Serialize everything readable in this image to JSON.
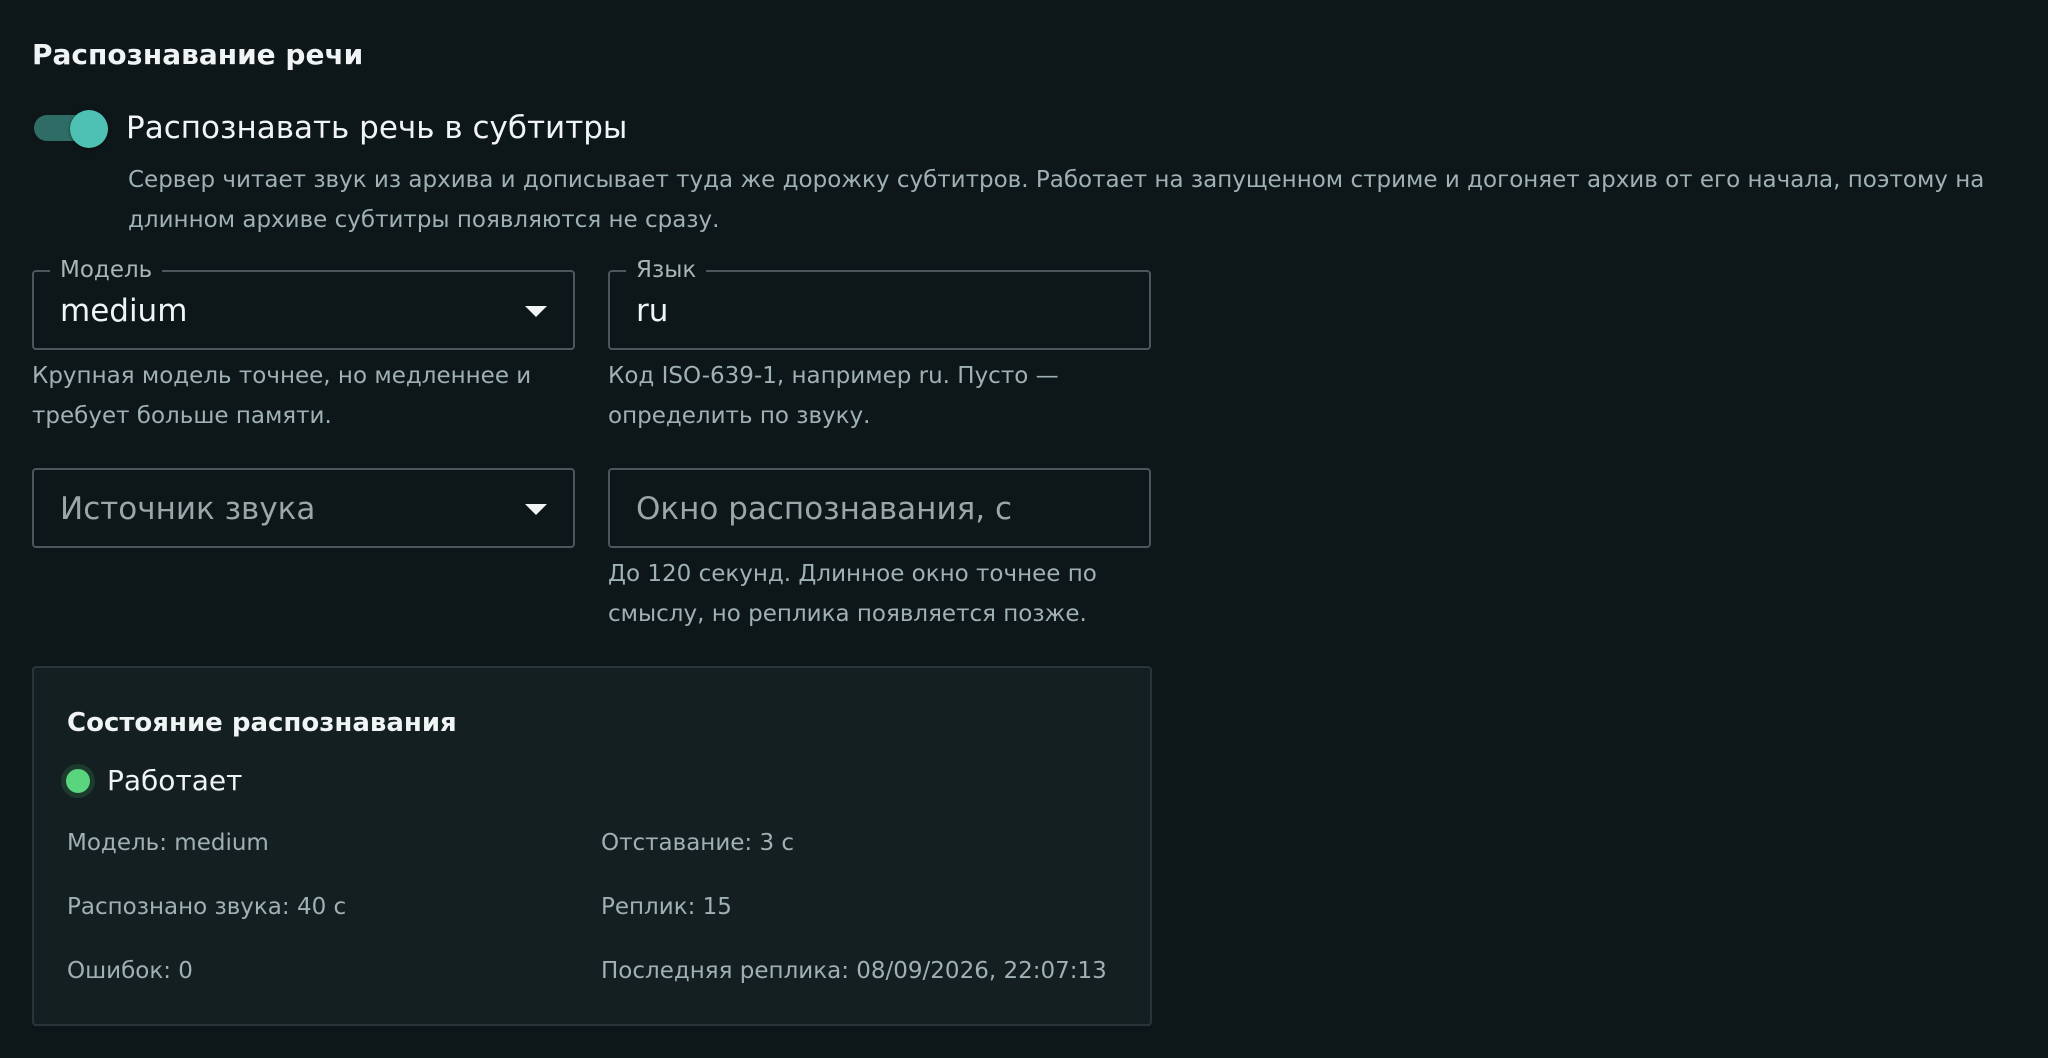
{
  "section": {
    "title": "Распознавание речи"
  },
  "toggle": {
    "label": "Распознавать речь в субтитры",
    "checked": true,
    "help": "Сервер читает звук из архива и дописывает туда же дорожку субтитров. Работает на запущенном стриме и догоняет архив от его начала, поэтому на длинном архиве субтитры появляются не сразу."
  },
  "model_field": {
    "legend": "Модель",
    "value": "medium",
    "helper": "Крупная модель точнее, но медленнее и требует больше памяти."
  },
  "language_field": {
    "legend": "Язык",
    "value": "ru",
    "helper": "Код ISO-639-1, например ru. Пусто — определить по звуку."
  },
  "audio_source_field": {
    "placeholder": "Источник звука"
  },
  "window_field": {
    "placeholder": "Окно распознавания, с",
    "helper": "До 120 секунд. Длинное окно точнее по смыслу, но реплика появляется позже."
  },
  "status": {
    "title": "Состояние распознавания",
    "state": "Работает",
    "state_color": "#5bd47e",
    "model": "Модель: medium",
    "lag": "Отставание: 3 с",
    "recognized": "Распознано звука: 40 с",
    "replicas": "Реплик: 15",
    "errors": "Ошибок: 0",
    "last_replica": "Последняя реплика: 08/09/2026, 22:07:13"
  },
  "colors": {
    "background": "#0d1619",
    "accent": "#4fc1b4",
    "card": "#141f22"
  }
}
